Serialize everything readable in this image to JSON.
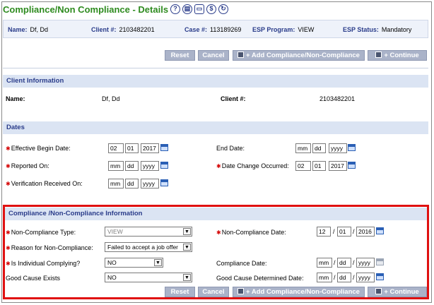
{
  "title": "Compliance/Non Compliance - Details",
  "title_icons": [
    "help-icon",
    "document-icon",
    "folder-icon",
    "history-icon",
    "refresh-icon"
  ],
  "info": {
    "name_label": "Name:",
    "name_value": "Df, Dd",
    "client_label": "Client #:",
    "client_value": "2103482201",
    "case_label": "Case #:",
    "case_value": "113189269",
    "esp_program_label": "ESP Program:",
    "esp_program_value": "VIEW",
    "esp_status_label": "ESP Status:",
    "esp_status_value": "Mandatory"
  },
  "buttons": {
    "reset": "Reset",
    "cancel": "Cancel",
    "add": "+ Add Compliance/Non-Compliance",
    "continue": "+ Continue"
  },
  "client_info": {
    "header": "Client Information",
    "name_label": "Name:",
    "name_value": "Df, Dd",
    "client_label": "Client #:",
    "client_value": "2103482201"
  },
  "dates": {
    "header": "Dates",
    "effective_begin_label": "Effective Begin Date:",
    "effective_begin": {
      "mm": "02",
      "dd": "01",
      "yyyy": "2017"
    },
    "end_date_label": "End Date:",
    "end_date": {
      "mm": "mm",
      "dd": "dd",
      "yyyy": "yyyy"
    },
    "reported_on_label": "Reported On:",
    "reported_on": {
      "mm": "mm",
      "dd": "dd",
      "yyyy": "yyyy"
    },
    "date_change_label": "Date Change Occurred:",
    "date_change": {
      "mm": "02",
      "dd": "01",
      "yyyy": "2017"
    },
    "verification_label": "Verification Received On:",
    "verification": {
      "mm": "mm",
      "dd": "dd",
      "yyyy": "yyyy"
    }
  },
  "compliance": {
    "header": "Compliance /Non-Compliance Information",
    "nc_type_label": "Non-Compliance Type:",
    "nc_type_value": "VIEW",
    "nc_date_label": "Non-Compliance Date:",
    "nc_date": {
      "mm": "12",
      "dd": "01",
      "yyyy": "2016"
    },
    "reason_label": "Reason for Non-Compliance:",
    "reason_value": "Failed to accept a job offer",
    "complying_label": "Is Individual Complying?",
    "complying_value": "NO",
    "compliance_date_label": "Compliance Date:",
    "compliance_date": {
      "mm": "mm",
      "dd": "dd",
      "yyyy": "yyyy"
    },
    "good_cause_label": "Good Cause Exists",
    "good_cause_value": "NO",
    "good_cause_date_label": "Good Cause Determined Date:",
    "good_cause_date": {
      "mm": "mm",
      "dd": "dd",
      "yyyy": "yyyy"
    }
  },
  "colors": {
    "title": "#2e8b1f",
    "section_header_bg": "#dbe4f3",
    "button_bg": "#aab3c9",
    "highlight": "#e01010"
  }
}
